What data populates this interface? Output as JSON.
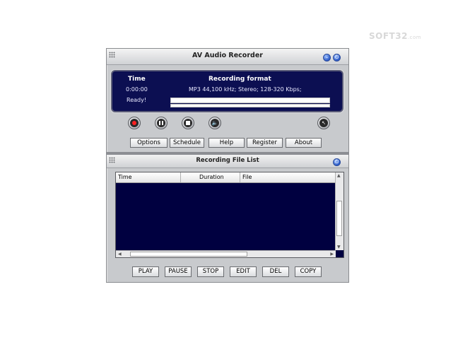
{
  "watermark": "SOFT32",
  "watermark_suffix": ".com",
  "window": {
    "title": "AV Audio Recorder",
    "minimize_glyph": "–",
    "close_glyph": "⏻"
  },
  "display": {
    "time_label": "Time",
    "format_label": "Recording format",
    "time_value": "0:00:00",
    "format_value": "MP3 44,100 kHz; Stereo;  128-320 Kbps;",
    "status": "Ready!"
  },
  "controls": {
    "record": "record",
    "pause": "pause",
    "stop": "stop",
    "volume": "🔈",
    "mini": "↖"
  },
  "menu_buttons": [
    "Options",
    "Schedule",
    "Help",
    "Register",
    "About"
  ],
  "file_list": {
    "title": "Recording File List",
    "columns": [
      "Time",
      "Duration",
      "File"
    ],
    "rows": []
  },
  "list_buttons": [
    "PLAY",
    "PAUSE",
    "STOP",
    "EDIT",
    "DEL",
    "COPY"
  ],
  "colors": {
    "display_bg": "#0c0f52",
    "list_bg": "#000040",
    "record_red": "#ff2020"
  }
}
